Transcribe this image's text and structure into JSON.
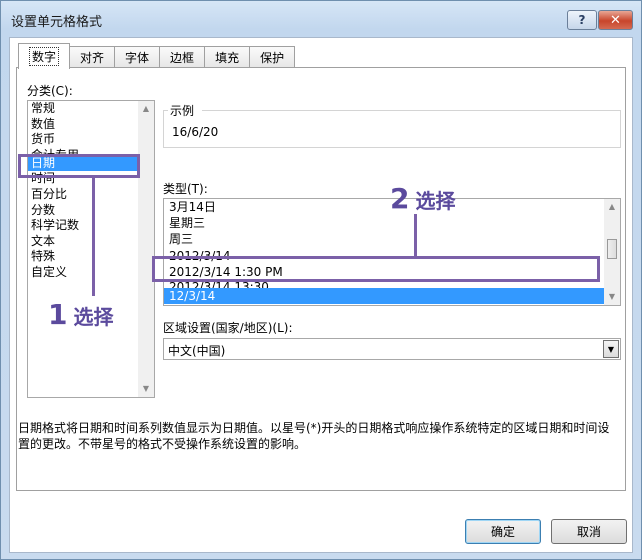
{
  "window": {
    "title": "设置单元格格式",
    "help_label": "?",
    "close_label": "✕"
  },
  "tabs": [
    "数字",
    "对齐",
    "字体",
    "边框",
    "填充",
    "保护"
  ],
  "category": {
    "label": "分类(C):",
    "items": [
      "常规",
      "数值",
      "货币",
      "会计专用",
      "日期",
      "时间",
      "百分比",
      "分数",
      "科学记数",
      "文本",
      "特殊",
      "自定义"
    ],
    "selected": "日期"
  },
  "sample": {
    "label": "示例",
    "value": "16/6/20"
  },
  "type": {
    "label": "类型(T):",
    "items": [
      "3月14日",
      "星期三",
      "周三",
      "2012/3/14",
      "2012/3/14 1:30 PM",
      "2012/3/14 13:30",
      "12/3/14"
    ],
    "selected": "12/3/14"
  },
  "locale": {
    "label": "区域设置(国家/地区)(L):",
    "value": "中文(中国)"
  },
  "description": "日期格式将日期和时间系列数值显示为日期值。以星号(*)开头的日期格式响应操作系统特定的区域日期和时间设置的更改。不带星号的格式不受操作系统设置的影响。",
  "buttons": {
    "ok": "确定",
    "cancel": "取消"
  },
  "annotations": {
    "step1_number": "1",
    "step1_text": "选择",
    "step2_number": "2",
    "step2_text": "选择"
  },
  "colors": {
    "selection": "#3399ff",
    "annotation": "#7b60a8"
  }
}
